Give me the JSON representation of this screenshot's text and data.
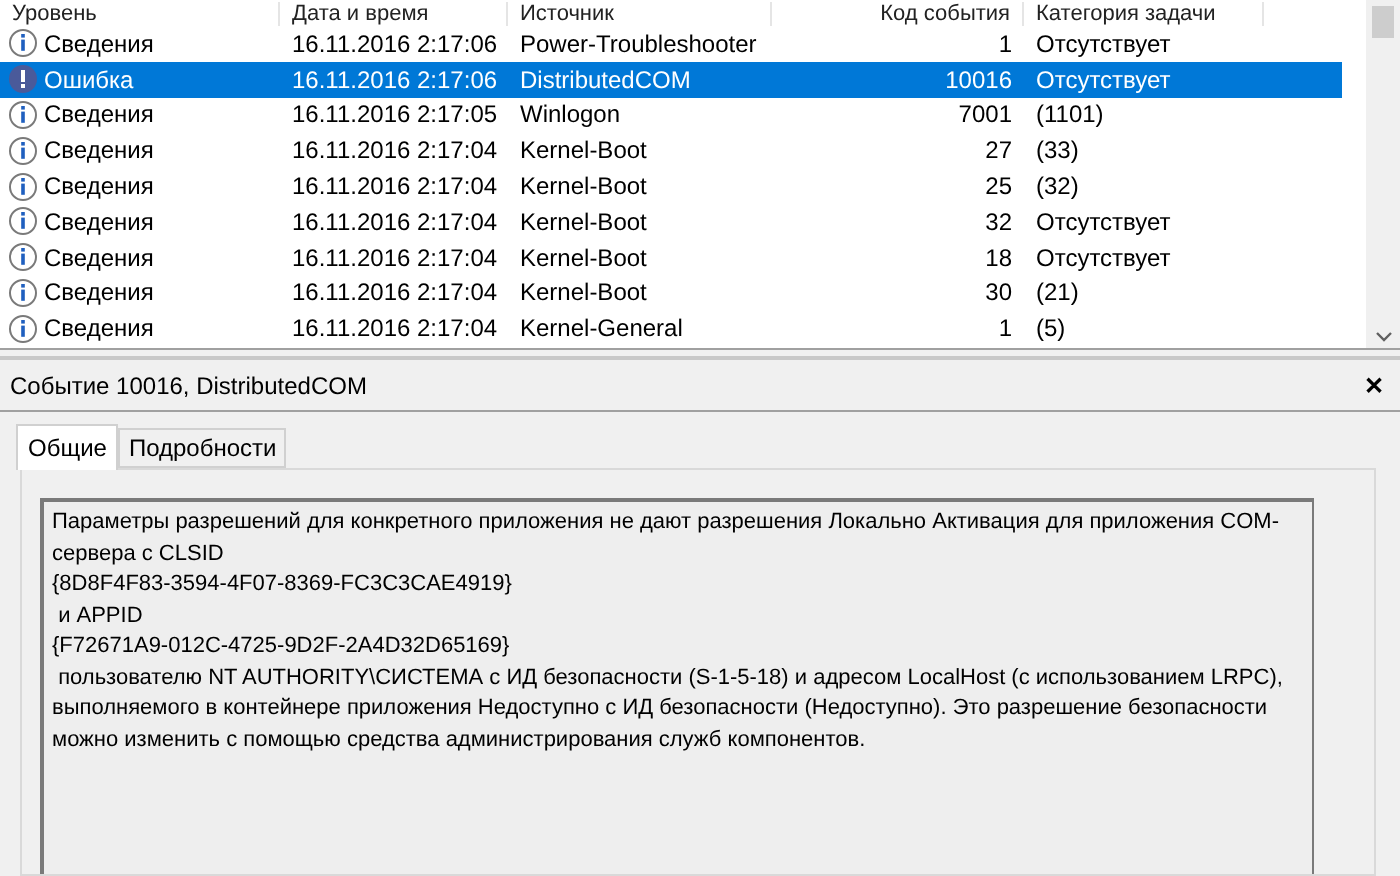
{
  "table": {
    "columns": [
      "Уровень",
      "Дата и время",
      "Источник",
      "Код события",
      "Категория задачи"
    ],
    "rows": [
      {
        "level": "Сведения",
        "kind": "info",
        "date": "16.11.2016 2:17:06",
        "source": "Power-Troubleshooter",
        "code": "1",
        "category": "Отсутствует",
        "selected": false
      },
      {
        "level": "Ошибка",
        "kind": "error",
        "date": "16.11.2016 2:17:06",
        "source": "DistributedCOM",
        "code": "10016",
        "category": "Отсутствует",
        "selected": true
      },
      {
        "level": "Сведения",
        "kind": "info",
        "date": "16.11.2016 2:17:05",
        "source": "Winlogon",
        "code": "7001",
        "category": "(1101)",
        "selected": false
      },
      {
        "level": "Сведения",
        "kind": "info",
        "date": "16.11.2016 2:17:04",
        "source": "Kernel-Boot",
        "code": "27",
        "category": "(33)",
        "selected": false
      },
      {
        "level": "Сведения",
        "kind": "info",
        "date": "16.11.2016 2:17:04",
        "source": "Kernel-Boot",
        "code": "25",
        "category": "(32)",
        "selected": false
      },
      {
        "level": "Сведения",
        "kind": "info",
        "date": "16.11.2016 2:17:04",
        "source": "Kernel-Boot",
        "code": "32",
        "category": "Отсутствует",
        "selected": false
      },
      {
        "level": "Сведения",
        "kind": "info",
        "date": "16.11.2016 2:17:04",
        "source": "Kernel-Boot",
        "code": "18",
        "category": "Отсутствует",
        "selected": false
      },
      {
        "level": "Сведения",
        "kind": "info",
        "date": "16.11.2016 2:17:04",
        "source": "Kernel-Boot",
        "code": "30",
        "category": "(21)",
        "selected": false
      },
      {
        "level": "Сведения",
        "kind": "info",
        "date": "16.11.2016 2:17:04",
        "source": "Kernel-General",
        "code": "1",
        "category": "(5)",
        "selected": false
      }
    ]
  },
  "details": {
    "title": "Событие 10016, DistributedCOM",
    "close": "✕",
    "tabs": [
      {
        "label": "Общие",
        "selected": true
      },
      {
        "label": "Подробности",
        "selected": false
      }
    ],
    "lines": [
      "Параметры разрешений для конкретного приложения не дают разрешения Локально Активация для приложения COM-сервера с CLSID",
      "{8D8F4F83-3594-4F07-8369-FC3C3CAE4919}",
      " и APPID",
      "{F72671A9-012C-4725-9D2F-2A4D32D65169}",
      " пользователю NT AUTHORITY\\СИСТЕМА с ИД безопасности (S-1-5-18) и адресом LocalHost (с использованием LRPC), выполняемого в контейнере приложения Недоступно с ИД безопасности (Недоступно). Это разрешение безопасности можно изменить с помощью средства администрирования служб компонентов."
    ]
  }
}
